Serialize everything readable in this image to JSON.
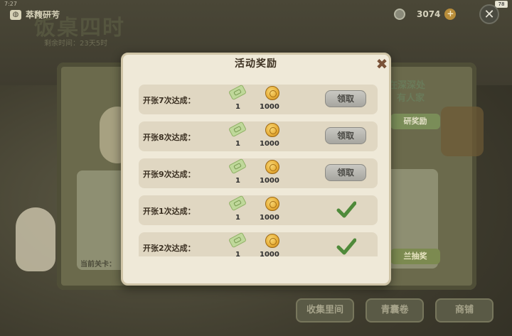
{
  "status_bar": {
    "time": "7:27",
    "battery": "78"
  },
  "top_left": {
    "label": "萃馥研芳"
  },
  "event": {
    "title": "饭桌四时",
    "remaining": "剩余时间：23天5时"
  },
  "currency": {
    "amount": "3074"
  },
  "side": {
    "banner_line1": "在深深处",
    "banner_line2": "有人家",
    "research_reward": "研奖励",
    "lottery": "兰抽奖",
    "current_stage": "当前关卡："
  },
  "bottom_buttons": [
    "收集里间",
    "青囊卷",
    "商铺"
  ],
  "modal": {
    "title": "活动奖励",
    "rows": [
      {
        "label": "开张7次达成：",
        "ticket_qty": "1",
        "coin_qty": "1000",
        "state": "claim",
        "button": "领取"
      },
      {
        "label": "开张8次达成：",
        "ticket_qty": "1",
        "coin_qty": "1000",
        "state": "claim",
        "button": "领取"
      },
      {
        "label": "开张9次达成：",
        "ticket_qty": "1",
        "coin_qty": "1000",
        "state": "claim",
        "button": "领取"
      },
      {
        "label": "开张1次达成：",
        "ticket_qty": "1",
        "coin_qty": "1000",
        "state": "claimed"
      },
      {
        "label": "开张2次达成：",
        "ticket_qty": "1",
        "coin_qty": "1000",
        "state": "claimed"
      }
    ]
  },
  "colors": {
    "check": "#4f8a3a",
    "claim_button": "#b8b7b1",
    "coin": "#e7ad36",
    "ticket": "#bfd89a"
  }
}
